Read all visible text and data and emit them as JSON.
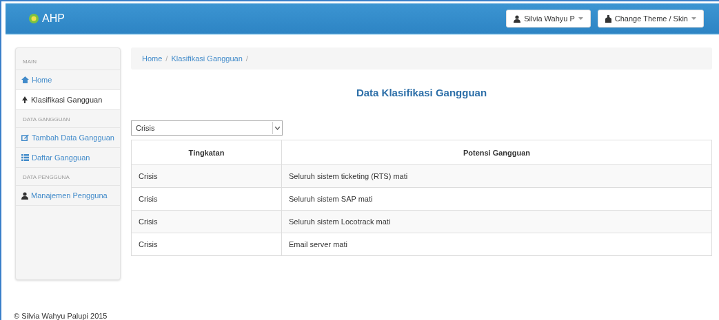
{
  "navbar": {
    "brand": "AHP",
    "user_menu": "Silvia Wahyu P",
    "theme_menu": "Change Theme / Skin"
  },
  "sidebar": {
    "items": [
      {
        "kind": "header",
        "label": "MAIN"
      },
      {
        "kind": "link",
        "label": "Home",
        "selected": false
      },
      {
        "kind": "link",
        "label": "Klasifikasi Gangguan",
        "selected": true
      },
      {
        "kind": "header",
        "label": "DATA GANGGUAN"
      },
      {
        "kind": "link",
        "label": "Tambah Data Gangguan",
        "selected": false
      },
      {
        "kind": "link",
        "label": "Daftar Gangguan",
        "selected": false
      },
      {
        "kind": "header",
        "label": "DATA PENGGUNA"
      },
      {
        "kind": "link",
        "label": "Manajemen Pengguna",
        "selected": false
      }
    ]
  },
  "breadcrumb": [
    {
      "label": "Home",
      "separator": "/"
    },
    {
      "label": "Klasifikasi Gangguan",
      "separator": "/"
    }
  ],
  "title": "Data Klasifikasi Gangguan",
  "filter": {
    "value": "Crisis"
  },
  "table": {
    "columns": [
      "Tingkatan",
      "Potensi Gangguan"
    ],
    "rows": [
      [
        "Crisis",
        "Seluruh sistem ticketing (RTS) mati"
      ],
      [
        "Crisis",
        "Seluruh sistem SAP mati"
      ],
      [
        "Crisis",
        "Seluruh sistem Locotrack mati"
      ],
      [
        "Crisis",
        "Email server mati"
      ]
    ]
  },
  "footer": "© Silvia Wahyu Palupi 2015"
}
